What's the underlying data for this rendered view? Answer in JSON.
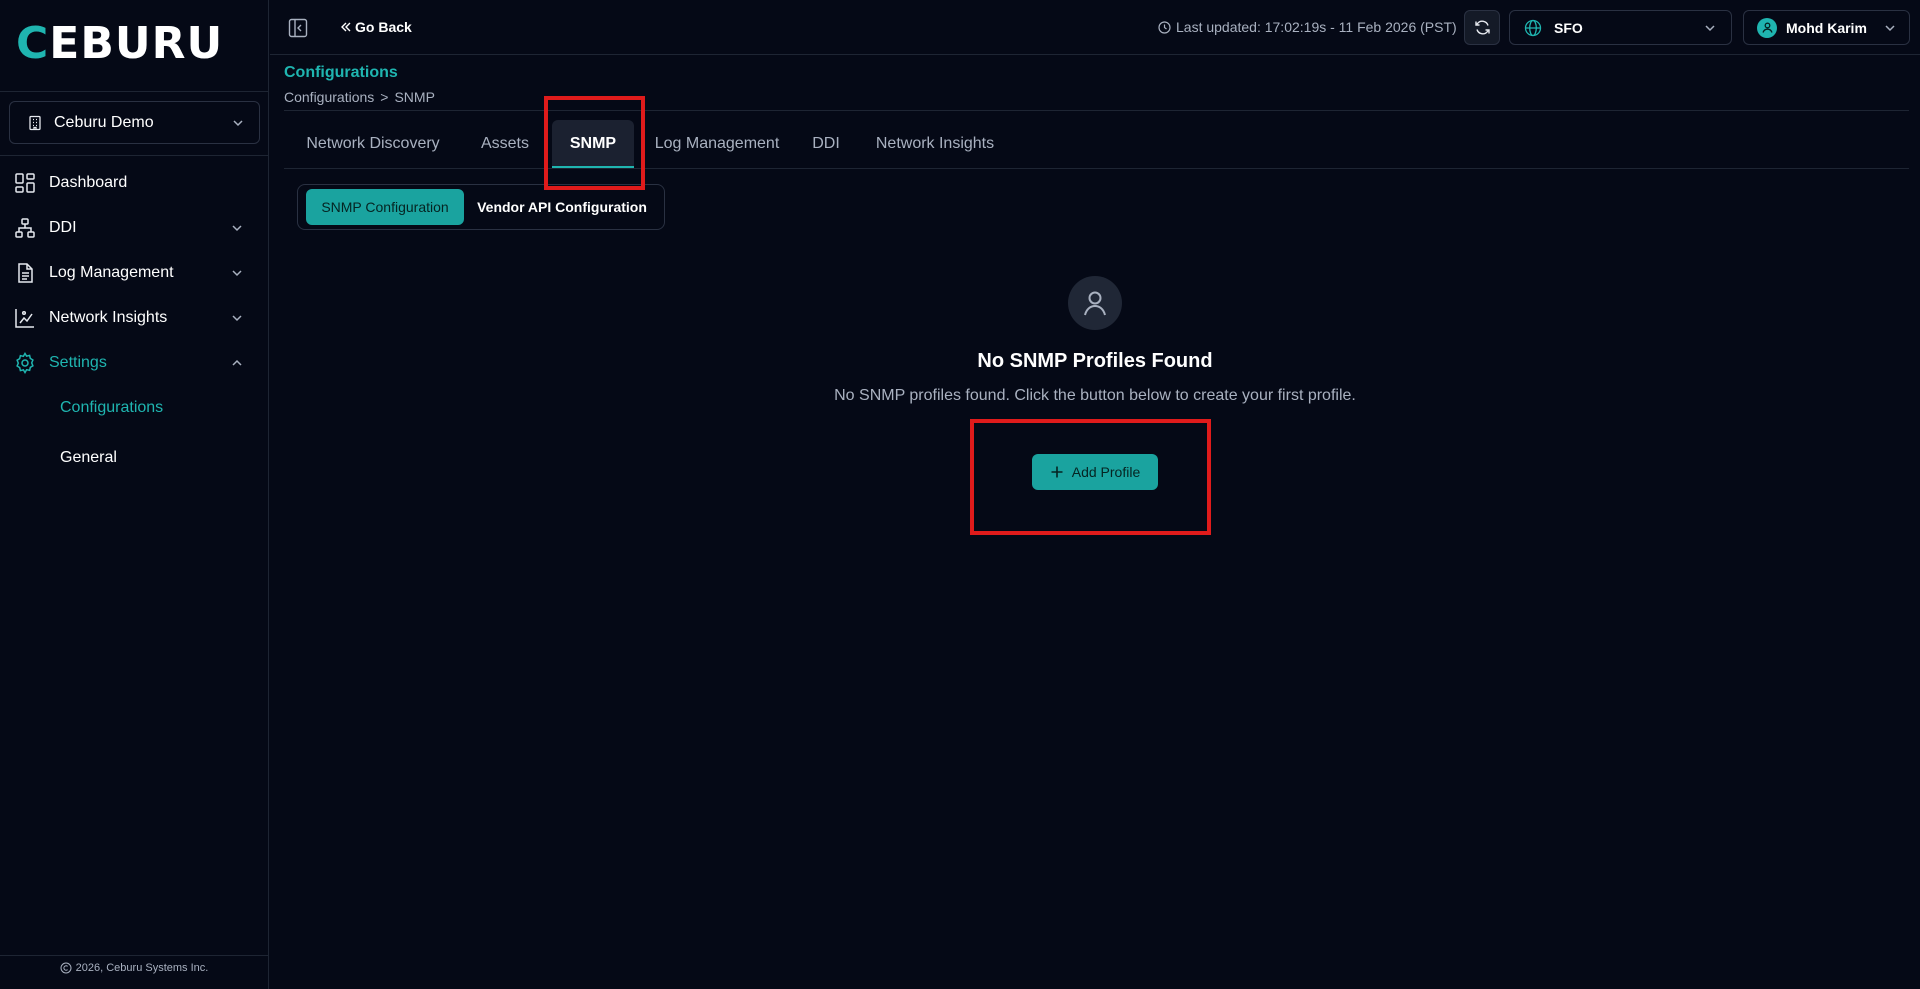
{
  "brand": {
    "logo_text": "EBURU",
    "logo_initial": "C"
  },
  "sidebar": {
    "org_selector": {
      "value": "Ceburu Demo"
    },
    "items": [
      {
        "label": "Dashboard",
        "icon": "dashboard-icon"
      },
      {
        "label": "DDI",
        "icon": "network-icon"
      },
      {
        "label": "Log Management",
        "icon": "file-text-icon"
      },
      {
        "label": "Network Insights",
        "icon": "chart-icon"
      },
      {
        "label": "Settings",
        "icon": "gear-icon"
      }
    ],
    "sub_items": [
      {
        "label": "Configurations"
      },
      {
        "label": "General"
      }
    ],
    "footer": "2026, Ceburu Systems Inc."
  },
  "topbar": {
    "go_back": "Go Back",
    "last_updated": "Last updated: 17:02:19s - 11 Feb 2026 (PST)",
    "site": "SFO",
    "user": "Mohd Karim"
  },
  "page": {
    "title": "Configurations",
    "breadcrumb": [
      "Configurations",
      ">",
      "SNMP"
    ]
  },
  "tabs": [
    {
      "label": "Network Discovery"
    },
    {
      "label": "Assets"
    },
    {
      "label": "SNMP"
    },
    {
      "label": "Log Management"
    },
    {
      "label": "DDI"
    },
    {
      "label": "Network Insights"
    }
  ],
  "subtabs": [
    {
      "label": "SNMP Configuration"
    },
    {
      "label": "Vendor API Configuration"
    }
  ],
  "empty_state": {
    "title": "No SNMP Profiles Found",
    "description": "No SNMP profiles found. Click the button below to create your first profile.",
    "button": "Add Profile"
  },
  "colors": {
    "accent": "#1fb5b0",
    "background": "#050916",
    "highlight": "#e01b1b"
  }
}
